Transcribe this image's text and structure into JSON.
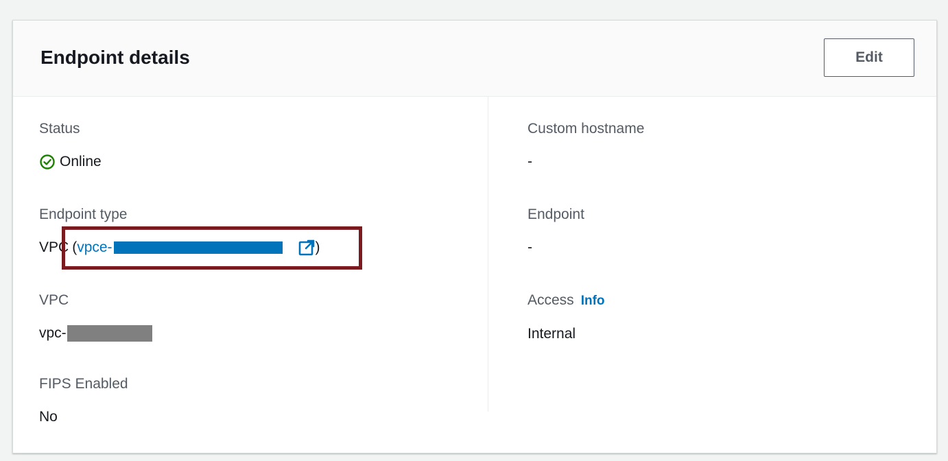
{
  "panel": {
    "title": "Endpoint details",
    "edit_label": "Edit"
  },
  "left": {
    "status": {
      "label": "Status",
      "value": "Online",
      "icon": "check-circle-icon",
      "color": "#1d8102"
    },
    "endpoint_type": {
      "label": "Endpoint type",
      "prefix": "VPC",
      "open_paren": "(",
      "link_text": "vpce-",
      "close_paren": ")",
      "icon": "external-link-icon"
    },
    "vpc": {
      "label": "VPC",
      "value": "vpc-"
    },
    "fips": {
      "label": "FIPS Enabled",
      "value": "No"
    }
  },
  "right": {
    "custom_hostname": {
      "label": "Custom hostname",
      "value": "-"
    },
    "endpoint": {
      "label": "Endpoint",
      "value": "-"
    },
    "access": {
      "label": "Access",
      "info_label": "Info",
      "value": "Internal"
    }
  },
  "colors": {
    "link": "#0073bb",
    "highlight": "#7b1a1f",
    "status_ok": "#1d8102"
  }
}
